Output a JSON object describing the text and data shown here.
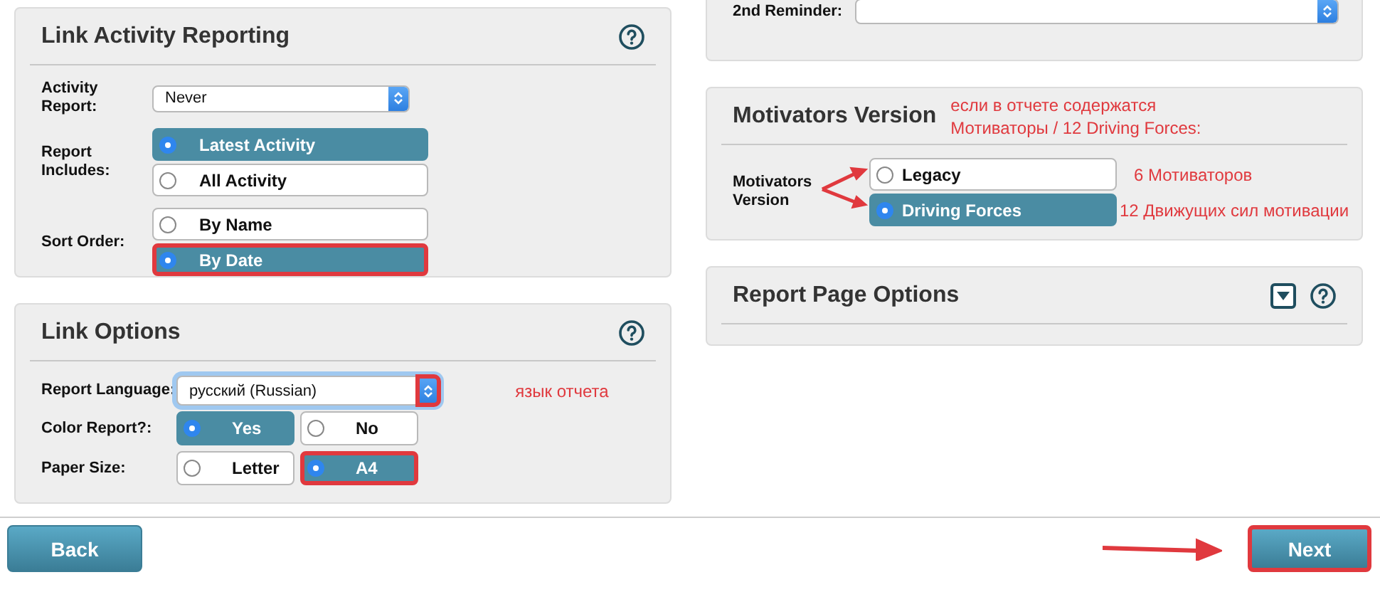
{
  "link_activity_reporting": {
    "title": "Link Activity Reporting",
    "rows": [
      {
        "kind": "select",
        "label": "Activity Report:",
        "value": "Never",
        "focused": false,
        "highlighted": false
      },
      {
        "kind": "radio",
        "label": "Report Includes:",
        "options": [
          {
            "label": "Latest Activity",
            "selected": true,
            "highlighted": false
          },
          {
            "label": "All Activity",
            "selected": false,
            "highlighted": false
          }
        ]
      },
      {
        "kind": "radio",
        "label": "Sort Order:",
        "options": [
          {
            "label": "By Name",
            "selected": false,
            "highlighted": false
          },
          {
            "label": "By Date",
            "selected": true,
            "highlighted": true
          }
        ]
      }
    ]
  },
  "link_options": {
    "title": "Link Options",
    "rows": [
      {
        "kind": "select",
        "label": "Report Language:",
        "value": "русский (Russian)",
        "focused": true,
        "highlighted": true,
        "note": "язык отчета"
      },
      {
        "kind": "radio",
        "label": "Color Report?:",
        "options": [
          {
            "label": "Yes",
            "selected": true,
            "highlighted": false
          },
          {
            "label": "No",
            "selected": false,
            "highlighted": false
          }
        ]
      },
      {
        "kind": "radio",
        "label": "Paper Size:",
        "options": [
          {
            "label": "Letter",
            "selected": false,
            "highlighted": false
          },
          {
            "label": "A4",
            "selected": true,
            "highlighted": true
          }
        ]
      }
    ]
  },
  "reminders": {
    "rows": [
      {
        "kind": "select",
        "label": "2nd Reminder:",
        "focused": false,
        "highlighted": false
      }
    ]
  },
  "motivators_version": {
    "title": "Motivators Version",
    "note": "если в отчете содержатся Мотиваторы / 12 Driving Forces:",
    "label": "Motivators Version",
    "options": [
      {
        "label": "Legacy",
        "selected": false,
        "highlighted": false,
        "note": "6 Мотиваторов"
      },
      {
        "label": "Driving Forces",
        "selected": true,
        "highlighted": false,
        "note": "12 Движущих сил мотивации"
      }
    ]
  },
  "report_page_options": {
    "title": "Report Page Options",
    "expanded": false
  },
  "footer": {
    "buttons": [
      {
        "label": "Back",
        "highlighted": false
      },
      {
        "label": "Next",
        "highlighted": true
      }
    ]
  }
}
